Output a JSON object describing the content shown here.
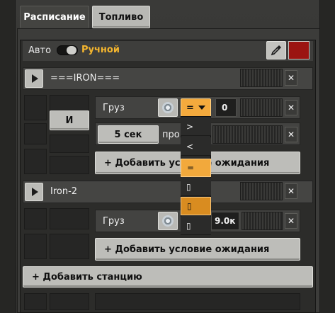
{
  "tabs": [
    {
      "label": "Расписание",
      "active": true
    },
    {
      "label": "Топливо",
      "active": false
    }
  ],
  "header": {
    "auto_label": "Авто",
    "manual_label": "Ручной",
    "mode_selected": "manual"
  },
  "stations": [
    {
      "name": "===IRON===",
      "and_label": "И",
      "conditions": [
        {
          "label": "Груз",
          "icon": "iron-plate-icon",
          "comparator": "=",
          "value": "0"
        },
        {
          "time_label": "5 сек",
          "text": "про"
        }
      ],
      "add_condition_label": "+ Добавить условие ожидания"
    },
    {
      "name": "Iron-2",
      "conditions": [
        {
          "label": "Груз",
          "icon": "iron-plate-icon",
          "value": "9.0к"
        }
      ],
      "add_condition_label": "+ Добавить условие ожидания"
    }
  ],
  "dropdown": {
    "options": [
      ">",
      "<",
      "=",
      "▯",
      "▯",
      "▯"
    ],
    "selected": "=",
    "highlighted": 4
  },
  "add_station_label": "+ Добавить станцию",
  "colors": {
    "accent": "#f4aa3d",
    "manual_text": "#f5b62e",
    "color_swatch": "#9b1412"
  }
}
